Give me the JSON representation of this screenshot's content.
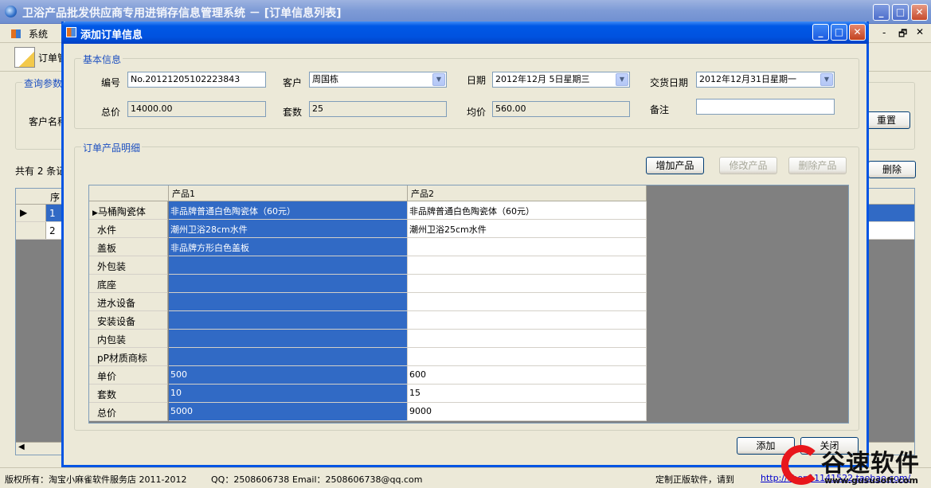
{
  "main_window": {
    "title": "卫浴产品批发供应商专用进销存信息管理系统 － [订单信息列表]",
    "menu": {
      "system": "系统"
    },
    "toolbar": {
      "order": "订单管"
    },
    "query_group": "查询参数",
    "customer_label": "客户名称",
    "reset_button": "重置",
    "record_count": "共有 2 条记",
    "delete_button": "删除",
    "grid": {
      "seq_header": "序",
      "rows": [
        "1",
        "2"
      ]
    }
  },
  "status_bar": {
    "copyright": "版权所有：淘宝小麻雀软件服务店 2011-2012",
    "qq": "QQ：2508606738",
    "email": "Email：2508606738@qq.com",
    "custom": "定制正版软件，请到",
    "link": "http://shop11141522.taobao.com/"
  },
  "watermark": {
    "brand": "谷速软件",
    "url": "www.gususoft.com"
  },
  "dialog": {
    "title": "添加订单信息",
    "basic_group": "基本信息",
    "fields": {
      "number_label": "编号",
      "number_value": "No.20121205102223843",
      "customer_label": "客户",
      "customer_value": "周国栋",
      "date_label": "日期",
      "date_value": "2012年12月 5日星期三",
      "delivery_label": "交货日期",
      "delivery_value": "2012年12月31日星期一",
      "total_label": "总价",
      "total_value": "14000.00",
      "sets_label": "套数",
      "sets_value": "25",
      "avg_label": "均价",
      "avg_value": "560.00",
      "remark_label": "备注",
      "remark_value": ""
    },
    "detail_group": "订单产品明细",
    "buttons": {
      "add_product": "增加产品",
      "edit_product": "修改产品",
      "delete_product": "删除产品",
      "add": "添加",
      "close": "关闭"
    },
    "detail_grid": {
      "columns": [
        "产品1",
        "产品2"
      ],
      "rows": [
        {
          "label": "马桶陶瓷体",
          "p1": "非品牌普通白色陶瓷体（60元）",
          "p2": "非品牌普通白色陶瓷体（60元）"
        },
        {
          "label": "水件",
          "p1": "潮州卫浴28cm水件",
          "p2": "潮州卫浴25cm水件"
        },
        {
          "label": "盖板",
          "p1": "非品牌方形白色盖板",
          "p2": ""
        },
        {
          "label": "外包装",
          "p1": "",
          "p2": ""
        },
        {
          "label": "底座",
          "p1": "",
          "p2": ""
        },
        {
          "label": "进水设备",
          "p1": "",
          "p2": ""
        },
        {
          "label": "安装设备",
          "p1": "",
          "p2": ""
        },
        {
          "label": "内包装",
          "p1": "",
          "p2": ""
        },
        {
          "label": "pP材质商标",
          "p1": "",
          "p2": ""
        },
        {
          "label": "单价",
          "p1": "500",
          "p2": "600"
        },
        {
          "label": "套数",
          "p1": "10",
          "p2": "15"
        },
        {
          "label": "总价",
          "p1": "5000",
          "p2": "9000"
        }
      ]
    }
  }
}
